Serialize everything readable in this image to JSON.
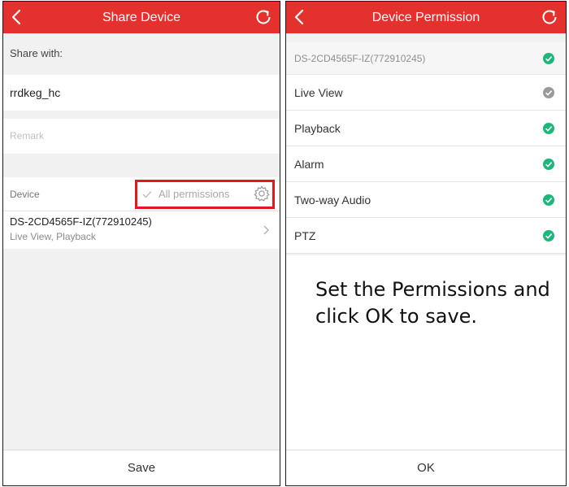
{
  "left": {
    "title": "Share Device",
    "share_with_label": "Share with:",
    "username": "rrdkeg_hc",
    "remark_placeholder": "Remark",
    "device_label": "Device",
    "all_permissions": "All permissions",
    "device_name": "DS-2CD4565F-IZ(772910245)",
    "device_permissions": "Live View, Playback",
    "save_label": "Save"
  },
  "right": {
    "title": "Device Permission",
    "device_name": "DS-2CD4565F-IZ(772910245)",
    "permissions": [
      {
        "label": "Live View",
        "checked": false
      },
      {
        "label": "Playback",
        "checked": true
      },
      {
        "label": "Alarm",
        "checked": true
      },
      {
        "label": "Two-way Audio",
        "checked": true
      },
      {
        "label": "PTZ",
        "checked": true
      }
    ],
    "instruction": "Set the Permissions and click OK to save.",
    "ok_label": "OK"
  },
  "colors": {
    "accent": "#e5312e",
    "highlight": "#e3171d",
    "check_on": "#1fb67a",
    "check_off": "#9a9a9a"
  },
  "icons": {
    "back": "back-arrow-icon",
    "refresh": "refresh-icon",
    "settings": "gear-icon",
    "check": "check-icon",
    "chevron": "chevron-right-icon"
  }
}
